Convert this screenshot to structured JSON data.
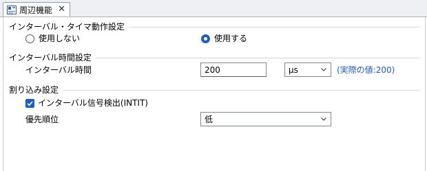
{
  "tab": {
    "label": "周辺機能",
    "close": "✕"
  },
  "interval_timer": {
    "title": "インターバル・タイマ動作設定",
    "options": [
      {
        "label": "使用しない",
        "selected": false
      },
      {
        "label": "使用する",
        "selected": true
      }
    ]
  },
  "interval_time": {
    "title": "インターバル時間設定",
    "field_label": "インターバル時間",
    "value": "200",
    "unit": "μs",
    "actual": "(実際の値:200)"
  },
  "interrupt": {
    "title": "割り込み設定",
    "checkbox_label": "インターバル信号検出(INTIT)",
    "checked": true,
    "priority_label": "優先順位",
    "priority_value": "低"
  },
  "colors": {
    "accent": "#1b5fc1"
  }
}
